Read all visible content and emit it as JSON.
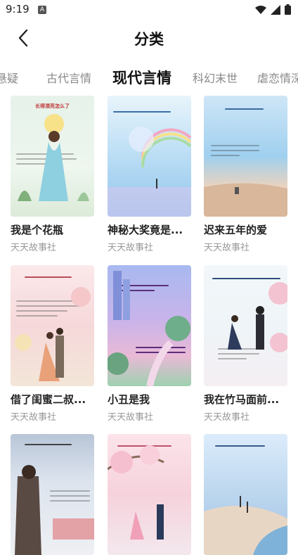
{
  "status": {
    "time": "9:19",
    "notif_letter": "A"
  },
  "header": {
    "title": "分类"
  },
  "tabs": [
    {
      "label": "悬疑",
      "active": false
    },
    {
      "label": "古代言情",
      "active": false
    },
    {
      "label": "现代言情",
      "active": true
    },
    {
      "label": "科幻末世",
      "active": false
    },
    {
      "label": "虐恋情深",
      "active": false
    }
  ],
  "books": [
    {
      "title": "我是个花瓶",
      "author": "天天故事社",
      "cover_text": "长得漂亮怎么了"
    },
    {
      "title": "神秘大奖竟是...",
      "author": "天天故事社",
      "cover_text": ""
    },
    {
      "title": "迟来五年的爱",
      "author": "天天故事社",
      "cover_text": ""
    },
    {
      "title": "借了闺蜜二叔...",
      "author": "天天故事社",
      "cover_text": ""
    },
    {
      "title": "小丑是我",
      "author": "天天故事社",
      "cover_text": ""
    },
    {
      "title": "我在竹马面前...",
      "author": "天天故事社",
      "cover_text": ""
    },
    {
      "title": "",
      "author": "",
      "cover_text": ""
    },
    {
      "title": "",
      "author": "",
      "cover_text": ""
    },
    {
      "title": "",
      "author": "",
      "cover_text": ""
    }
  ],
  "colors": {
    "accent": "#111111",
    "muted": "#888888"
  }
}
